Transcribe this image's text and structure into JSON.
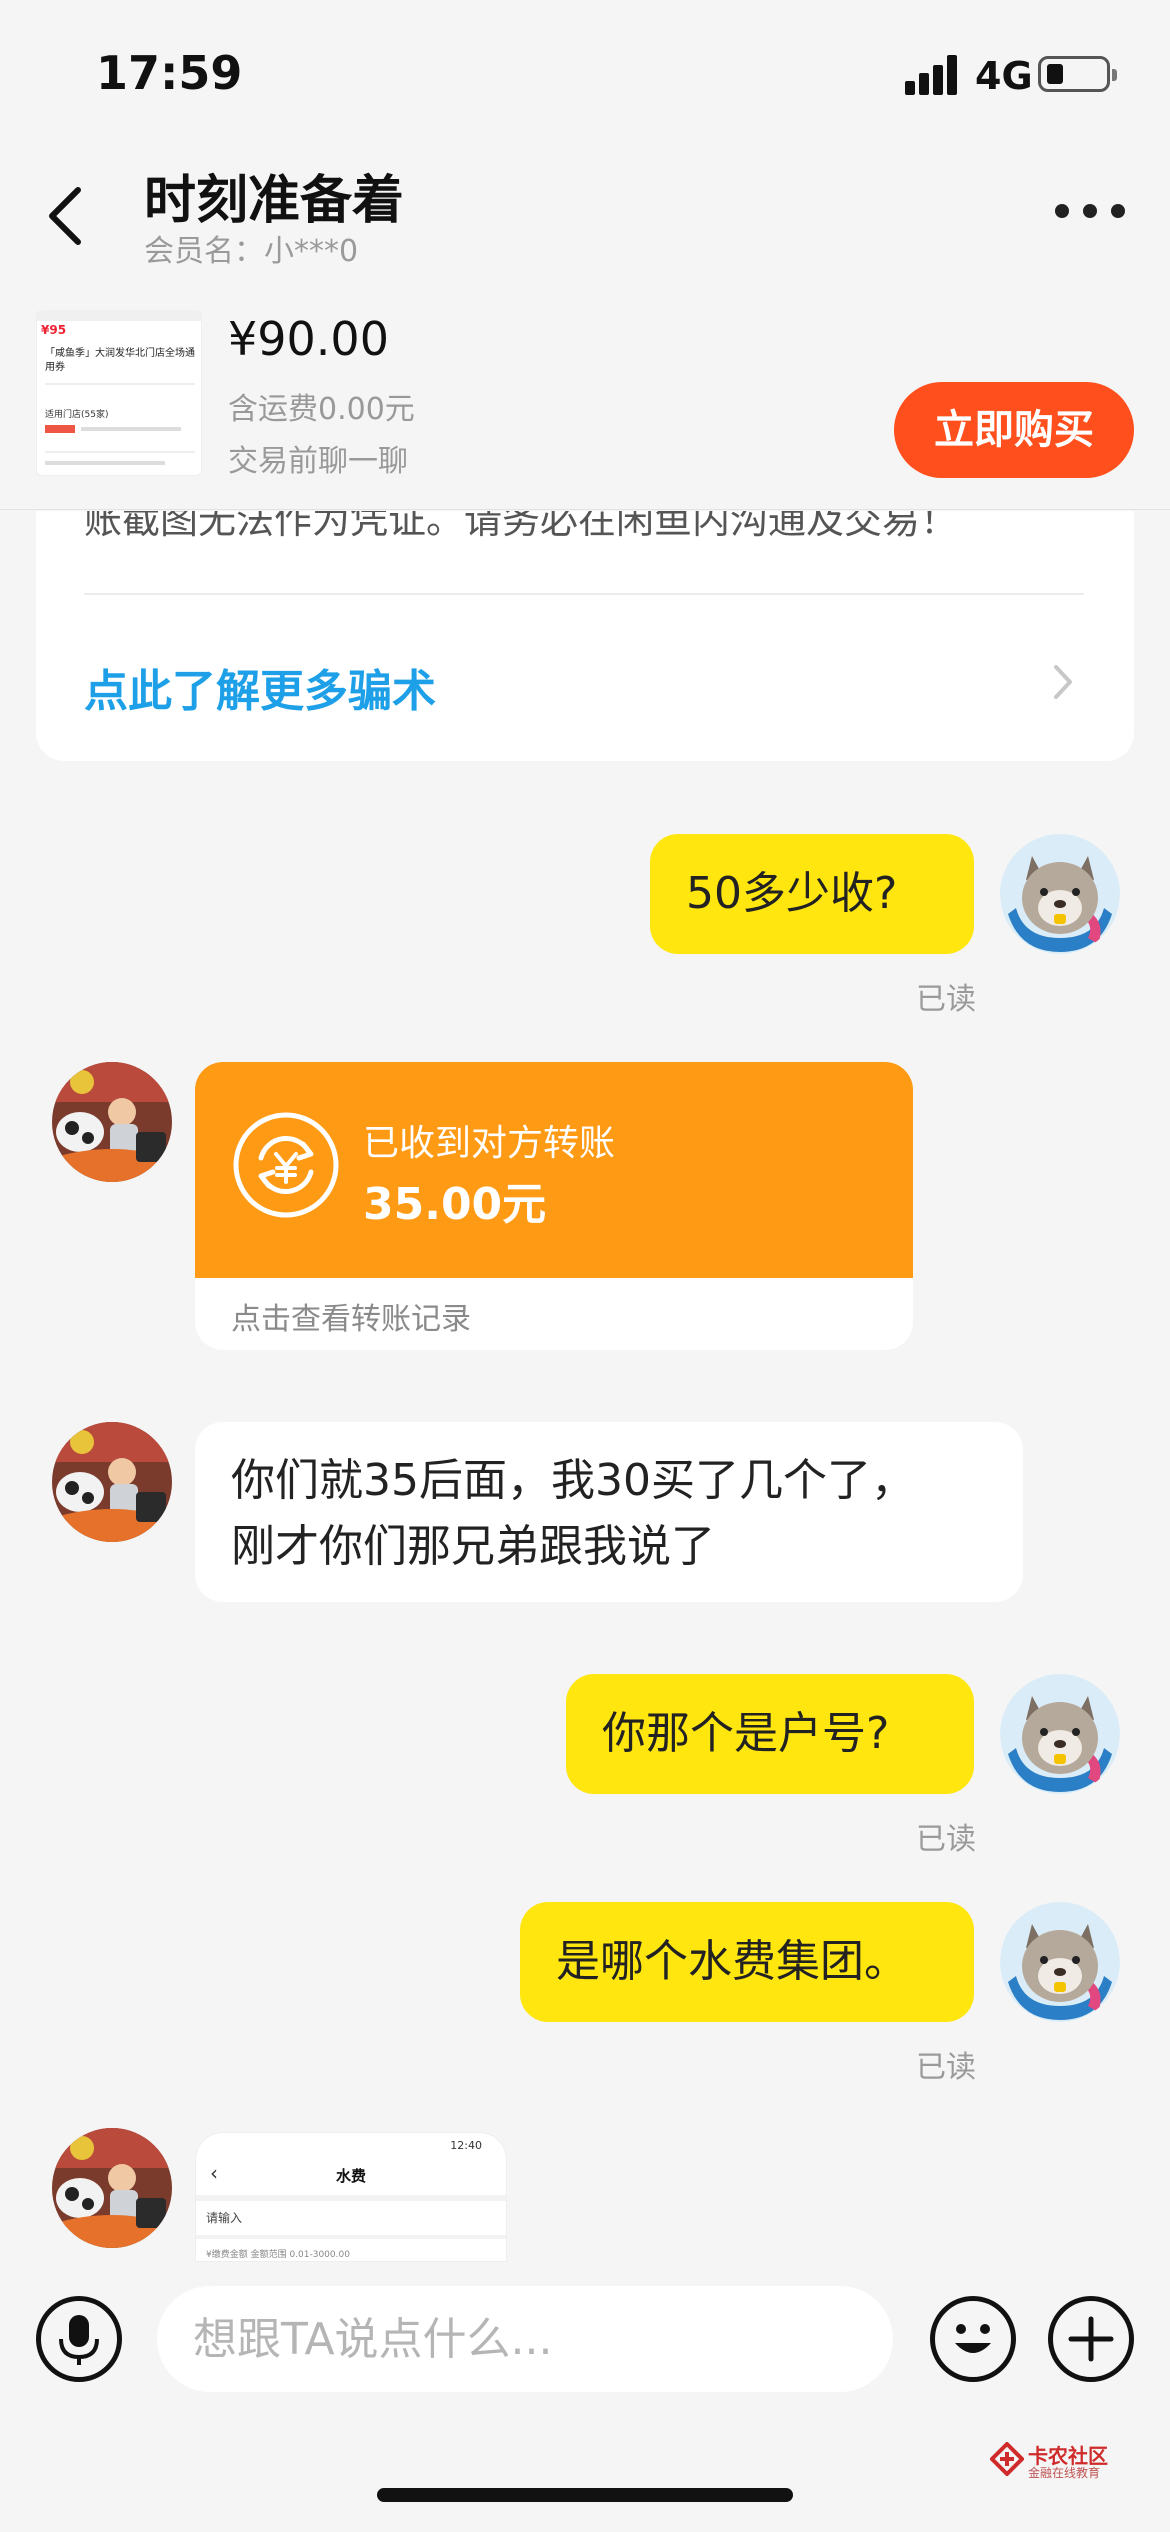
{
  "status_bar": {
    "time": "17:59",
    "network": "4G"
  },
  "header": {
    "title": "时刻准备着",
    "member_label": "会员名：小***0"
  },
  "product": {
    "price": "¥90.00",
    "shipping": "含运费0.00元",
    "hint": "交易前聊一聊",
    "buy_label": "立即购买",
    "thumb_price": "¥95",
    "thumb_title": "「咸鱼季」大润发华北门店全场通用券",
    "thumb_line1": "适用门店(55家)"
  },
  "notice": {
    "clipped_text": "账截图无法作为凭证。请务必在闲鱼内沟通及交易！",
    "link_label": "点此了解更多骗术"
  },
  "messages": {
    "m1_text": "50多少收?",
    "m1_status": "已读",
    "transfer_label": "已收到对方转账",
    "transfer_amount": "35.00元",
    "transfer_footer": "点击查看转账记录",
    "m3_line1": "你们就35后面，我30买了几个了，",
    "m3_line2": "刚才你们那兄弟跟我说了",
    "m4_text": "你那个是户号?",
    "m4_status": "已读",
    "m5_text": "是哪个水费集团。",
    "m5_status": "已读"
  },
  "screenshot_preview": {
    "time": "12:40",
    "title": "水费",
    "input_hint": "请输入",
    "amount_label": "¥缴费金额 金额范围 0.01-3000.00"
  },
  "input": {
    "placeholder": "想跟TA说点什么..."
  },
  "watermark": {
    "name": "卡农社区",
    "tagline": "金融在线教育"
  },
  "colors": {
    "accent_yellow": "#ffe60f",
    "buy_orange": "#ff4f1c",
    "transfer_orange": "#ff9a14",
    "link_blue": "#1ea0e8"
  }
}
